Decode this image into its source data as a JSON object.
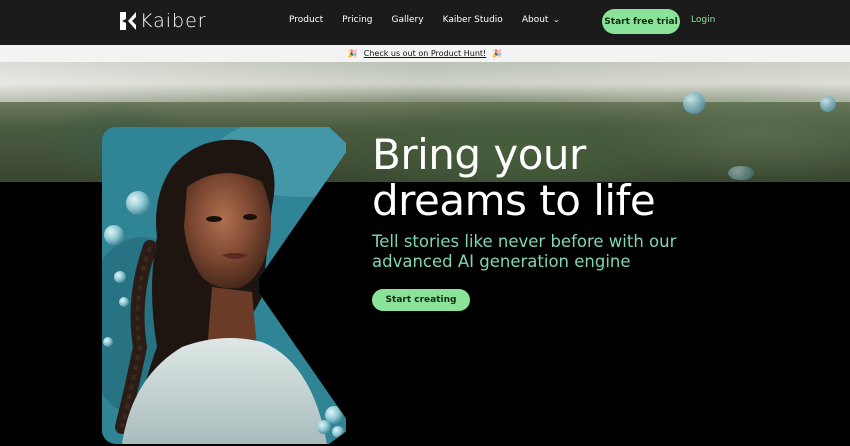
{
  "nav": {
    "logo_text": "Kaiber",
    "links": [
      "Product",
      "Pricing",
      "Gallery",
      "Kaiber Studio",
      "About"
    ],
    "about_chevron": "chevron-down-icon",
    "cta_label": "Start free trial",
    "login_label": "Login"
  },
  "promo": {
    "text": "Check us out on Product Hunt!",
    "left_icon": "party-popper-icon",
    "right_icon": "party-popper-icon"
  },
  "hero": {
    "title_line1": "Bring your",
    "title_line2": "dreams to life",
    "subtitle": "Tell stories like never before with our advanced AI generation engine",
    "cta_label": "Start creating"
  },
  "colors": {
    "accent": "#8be39a",
    "subtitle": "#7fd6b4",
    "nav_bg": "#1b1b1b",
    "page_bg": "#000000"
  }
}
